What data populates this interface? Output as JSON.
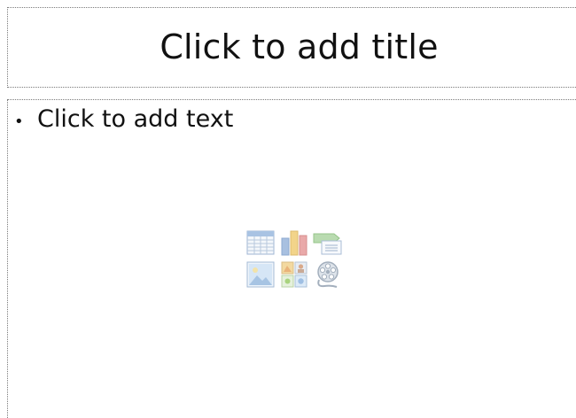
{
  "slide": {
    "title_placeholder": "Click to add title",
    "body_placeholder": {
      "bullet": "•",
      "text": "Click to add text"
    },
    "content_icons": [
      "insert-table-icon",
      "insert-chart-icon",
      "insert-smartart-icon",
      "insert-picture-icon",
      "insert-clip-art-icon",
      "insert-media-clip-icon"
    ],
    "colors": {
      "placeholder_border": "#7a7a7a",
      "text": "#111111",
      "icon_tint": "#bcd0e8"
    }
  }
}
